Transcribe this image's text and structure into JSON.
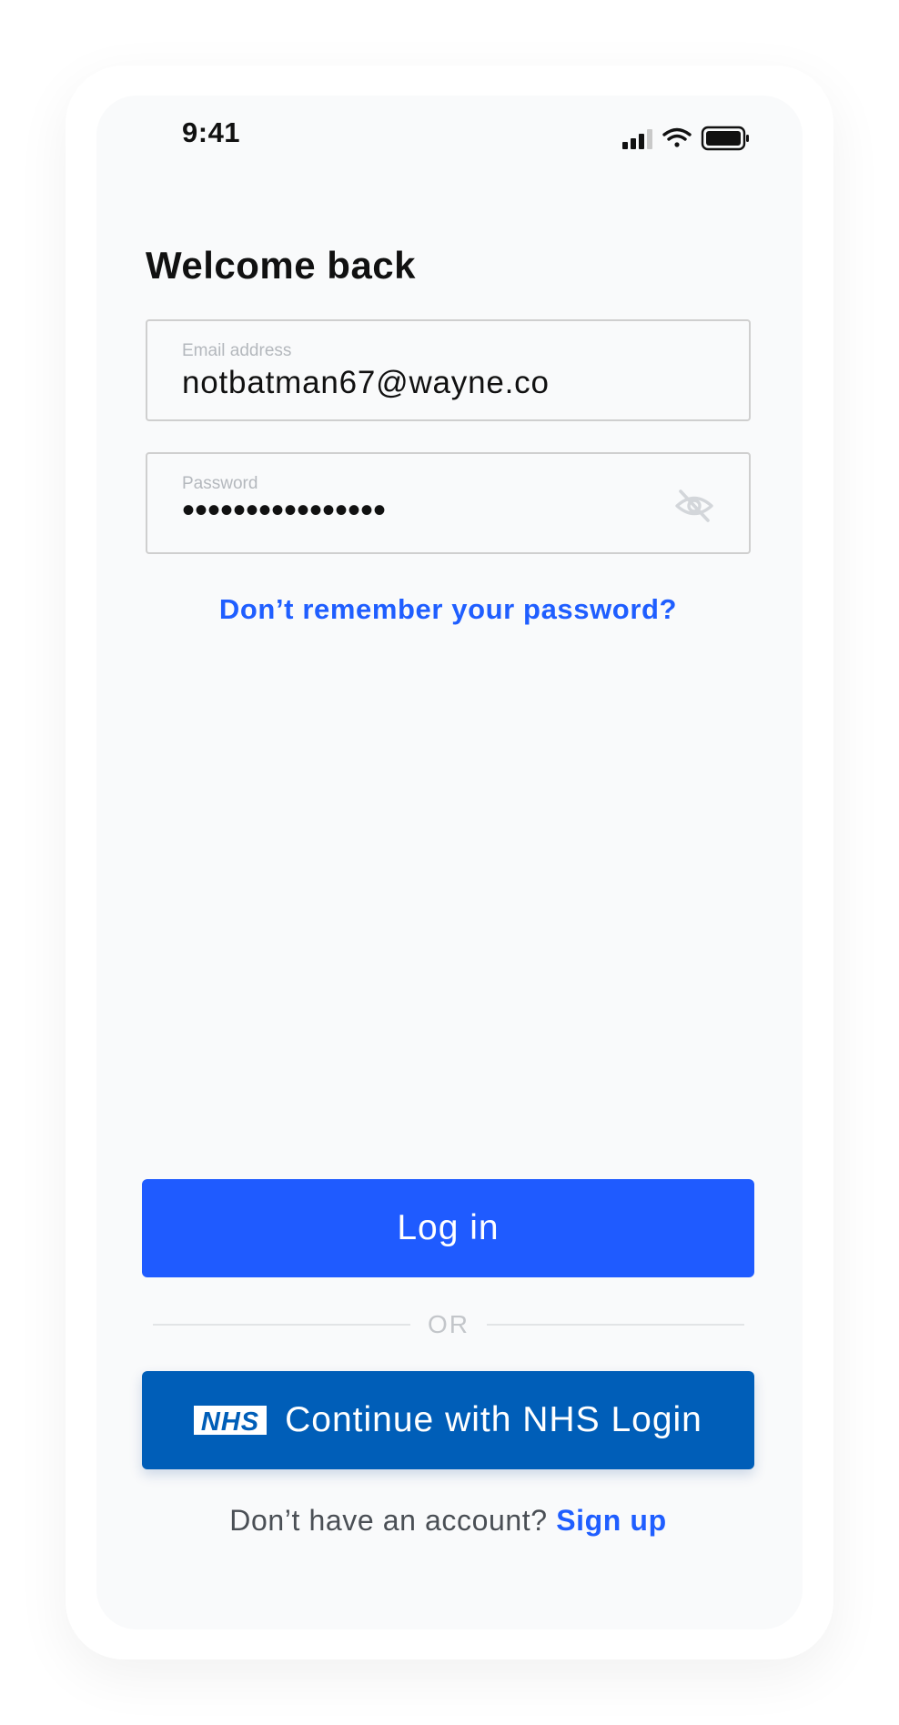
{
  "status_bar": {
    "time": "9:41",
    "icons": [
      "cellular-signal-icon",
      "wifi-icon",
      "battery-icon"
    ]
  },
  "page": {
    "title": "Welcome back"
  },
  "email_field": {
    "label": "Email address",
    "value": "notbatman67@wayne.co"
  },
  "password_field": {
    "label": "Password",
    "value": "••••••••••••••••",
    "toggle_icon": "eye-off-icon"
  },
  "forgot_password_link": "Don’t remember your password?",
  "login_button": {
    "label": "Log in"
  },
  "divider_text": "OR",
  "nhs_button": {
    "logo_text": "NHS",
    "label": "Continue with NHS Login"
  },
  "signup": {
    "prompt": "Don’t have an account?",
    "link": "Sign up"
  },
  "colors": {
    "primary": "#1f5bff",
    "nhs_blue": "#005eb8",
    "link": "#1f5eff",
    "screen_bg": "#f9fafb"
  }
}
